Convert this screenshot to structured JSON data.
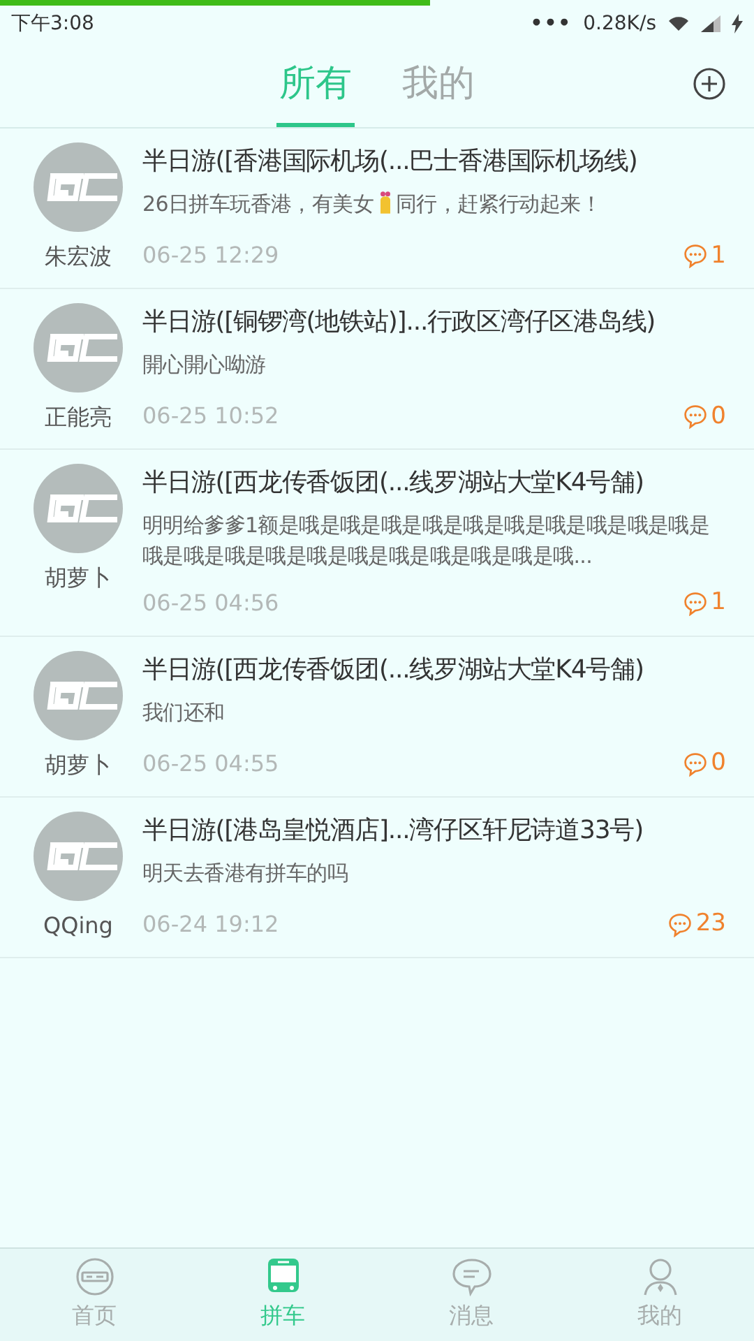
{
  "loading_bar": {
    "level": 0.57
  },
  "status_bar": {
    "time": "下午3:08",
    "dots": "•••",
    "speed": "0.28K/s"
  },
  "tabs": [
    {
      "label": "所有",
      "selected": true
    },
    {
      "label": "我的",
      "selected": false
    }
  ],
  "posts": [
    {
      "author": "朱宏波",
      "title": "半日游([香港国际机场(...巴士香港国际机场线)",
      "body": [
        "26日拼车玩香港，有美女",
        "同行，赶紧行动起来！"
      ],
      "time": "06-25 12:29",
      "comments": "1"
    },
    {
      "author": "正能亮",
      "title": "半日游([铜锣湾(地铁站)]...行政区湾仔区港岛线)",
      "body": [
        "開心開心呦游"
      ],
      "time": "06-25 10:52",
      "comments": "0"
    },
    {
      "author": "胡萝卜",
      "title": "半日游([西龙传香饭团(...线罗湖站大堂K4号舗)",
      "body": [
        "明明给爹爹1额是哦是哦是哦是哦是哦是哦是哦是哦是哦是哦是哦是哦是哦是哦是哦是哦是哦是哦是哦是哦是哦..."
      ],
      "time": "06-25 04:56",
      "comments": "1"
    },
    {
      "author": "胡萝卜",
      "title": "半日游([西龙传香饭团(...线罗湖站大堂K4号舗)",
      "body": [
        "我们还和"
      ],
      "time": "06-25 04:55",
      "comments": "0"
    },
    {
      "author": "QQing",
      "title": "半日游([港岛皇悦酒店]...湾仔区轩尼诗道33号)",
      "body": [
        "明天去香港有拼车的吗"
      ],
      "time": "06-24 19:12",
      "comments": "23"
    }
  ],
  "nav": [
    {
      "label": "首页",
      "kind": "home",
      "selected": false
    },
    {
      "label": "拼车",
      "kind": "bus",
      "selected": true
    },
    {
      "label": "消息",
      "kind": "chat",
      "selected": false
    },
    {
      "label": "我的",
      "kind": "user",
      "selected": false
    }
  ]
}
